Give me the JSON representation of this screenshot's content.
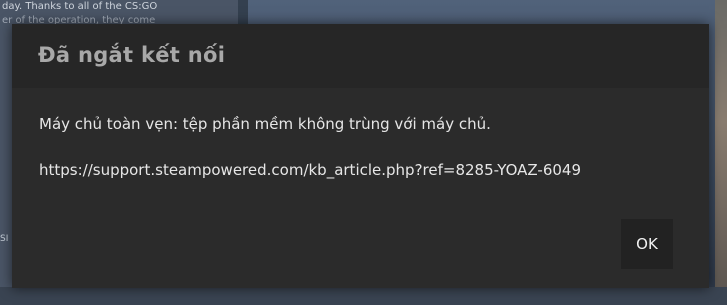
{
  "background": {
    "news_line_1": "day. Thanks to all of the CS:GO",
    "news_line_2": "er of the operation, they come",
    "side_text": "SI"
  },
  "dialog": {
    "title": "Đã ngắt kết nối",
    "message": "Máy chủ toàn vẹn: tệp phần mềm không trùng với máy chủ.",
    "link": "https://support.steampowered.com/kb_article.php?ref=8285-YOAZ-6049",
    "ok_label": "OK"
  },
  "colors": {
    "dialog_bg": "#2b2b2b",
    "header_bg": "#262626",
    "title_text": "#a8a8a8",
    "body_text": "#e6e6e6",
    "button_bg": "#222222"
  }
}
